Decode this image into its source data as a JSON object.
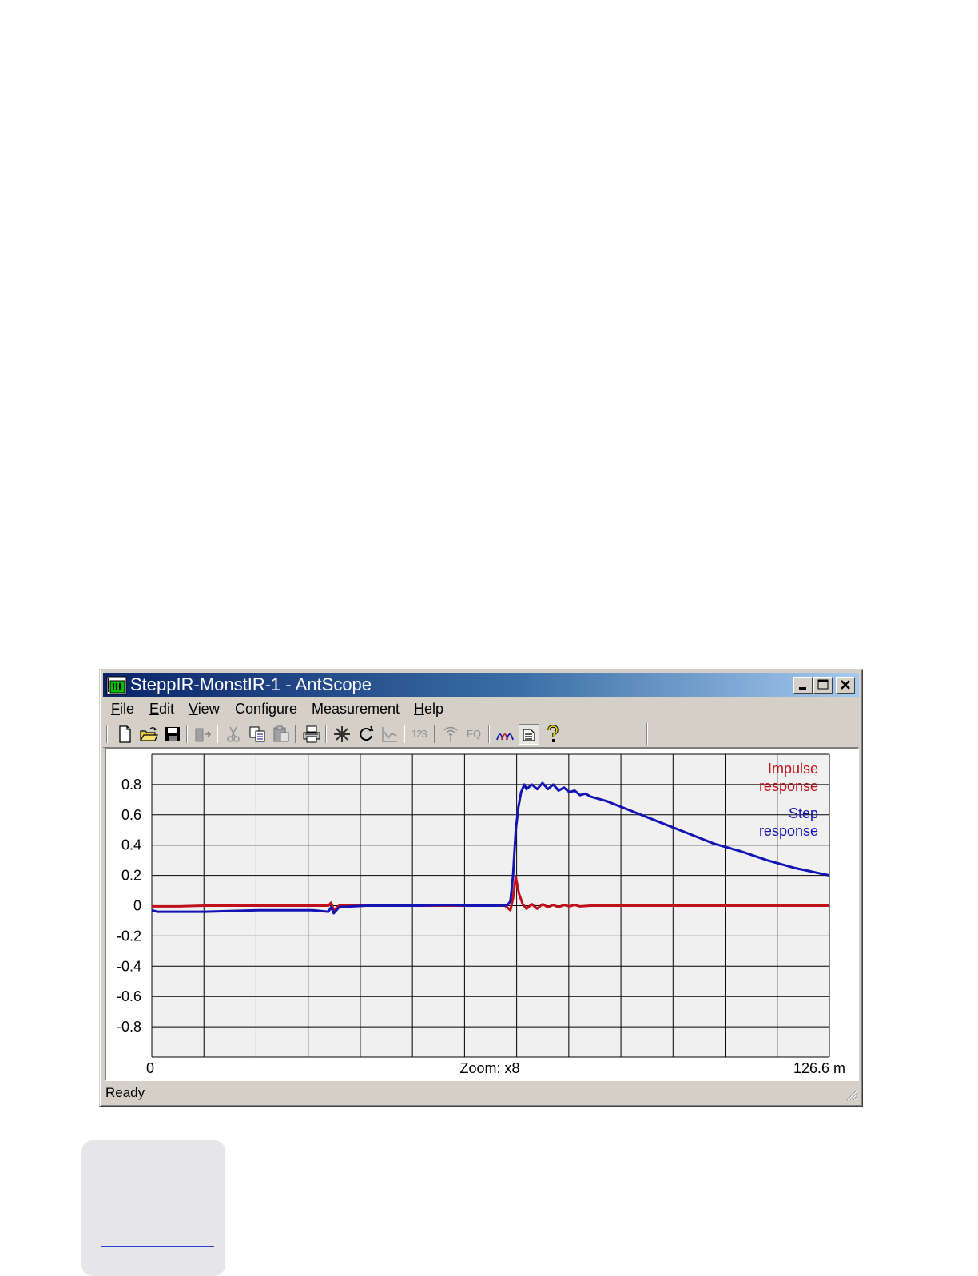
{
  "window": {
    "title": "SteppIR-MonstIR-1 - AntScope",
    "title_buttons": [
      "minimize-icon",
      "maximize-icon",
      "close-icon"
    ]
  },
  "menu": [
    {
      "underline": "F",
      "rest": "ile"
    },
    {
      "underline": "E",
      "rest": "dit"
    },
    {
      "underline": "V",
      "rest": "iew"
    },
    {
      "underline": "",
      "rest": "Configure"
    },
    {
      "underline": "",
      "rest": "Measurement"
    },
    {
      "underline": "H",
      "rest": "elp"
    }
  ],
  "toolbar": {
    "buttons": [
      {
        "icon": "new-document-icon",
        "enabled": true
      },
      {
        "icon": "open-folder-icon",
        "enabled": true
      },
      {
        "icon": "save-icon",
        "enabled": true
      },
      {
        "icon": "export-icon",
        "enabled": false
      },
      {
        "icon": "cut-icon",
        "enabled": false
      },
      {
        "icon": "copy-icon",
        "enabled": true
      },
      {
        "icon": "paste-icon",
        "enabled": false
      },
      {
        "icon": "print-icon",
        "enabled": true
      },
      {
        "icon": "scan-icon",
        "enabled": true
      },
      {
        "icon": "refresh-icon",
        "enabled": true
      },
      {
        "icon": "graph-icon",
        "enabled": false
      },
      {
        "icon": "numbers-icon",
        "label": "123",
        "enabled": false
      },
      {
        "icon": "antenna-icon",
        "enabled": false
      },
      {
        "icon": "fq-icon",
        "label": "FQ",
        "enabled": false
      },
      {
        "icon": "tdr-icon",
        "enabled": true
      },
      {
        "icon": "notes-icon",
        "enabled": true,
        "pressed": true
      },
      {
        "icon": "help-icon",
        "enabled": true
      }
    ]
  },
  "chart": {
    "x_start_label": "0",
    "x_center_label": "Zoom: x8",
    "x_end_label": "126.6 m",
    "legend": {
      "impulse_line1": "Impulse",
      "impulse_line2": "response",
      "step_line1": "Step",
      "step_line2": "response"
    },
    "colors": {
      "impulse": "#c0101a",
      "step": "#1414b4",
      "grid_bg": "#f0f0f0",
      "grid_line": "#000000"
    }
  },
  "chart_data": {
    "type": "line",
    "xlabel": "",
    "ylabel": "",
    "xlim": [
      0,
      126.6
    ],
    "ylim": [
      -1,
      1
    ],
    "yticks": [
      0.8,
      0.6,
      0.4,
      0.2,
      0,
      -0.2,
      -0.4,
      -0.6,
      -0.8
    ],
    "ytick_labels": [
      "0.8",
      "0.6",
      "0.4",
      "0.2",
      "0",
      "-0.2",
      "-0.4",
      "-0.6",
      "-0.8"
    ],
    "grid": true,
    "legend_position": "top-right",
    "series": [
      {
        "name": "Impulse response",
        "x": [
          0,
          5,
          10,
          20,
          30,
          33,
          33.5,
          34,
          35,
          40,
          50,
          60,
          66,
          67,
          67.5,
          68,
          68.6,
          69.3,
          70,
          71,
          72,
          73,
          74,
          75,
          76,
          77,
          78,
          79,
          80,
          82,
          84,
          86,
          90,
          95,
          100,
          105,
          110,
          115,
          120,
          126.6
        ],
        "y": [
          -0.005,
          -0.005,
          0.0,
          0.0,
          0.0,
          0.0,
          0.02,
          -0.03,
          0.0,
          0.0,
          0.0,
          0.0,
          0.0,
          -0.03,
          0.05,
          0.19,
          0.08,
          0.01,
          -0.02,
          0.01,
          -0.02,
          0.01,
          -0.01,
          0.005,
          -0.01,
          0.005,
          -0.005,
          0.005,
          -0.005,
          0.0,
          0.0,
          0.0,
          0.0,
          0.0,
          0.0,
          0.0,
          0.0,
          0.0,
          0.0,
          0.0
        ]
      },
      {
        "name": "Step response",
        "x": [
          0,
          1,
          5,
          10,
          15,
          20,
          25,
          30,
          33,
          33.5,
          34,
          35,
          40,
          50,
          55,
          60,
          65,
          66.5,
          67,
          67.5,
          68,
          68.5,
          69,
          69.6,
          70,
          71,
          72,
          73,
          74,
          75,
          76,
          77,
          78,
          79,
          80,
          81,
          82,
          85,
          90,
          95,
          100,
          105,
          110,
          115,
          120,
          126.6
        ],
        "y": [
          -0.03,
          -0.04,
          -0.04,
          -0.04,
          -0.035,
          -0.03,
          -0.03,
          -0.03,
          -0.04,
          -0.01,
          -0.05,
          -0.01,
          0.0,
          0.0,
          0.005,
          0.0,
          0.0,
          0.005,
          0.03,
          0.2,
          0.5,
          0.65,
          0.75,
          0.8,
          0.77,
          0.8,
          0.77,
          0.81,
          0.77,
          0.8,
          0.76,
          0.78,
          0.75,
          0.76,
          0.73,
          0.74,
          0.72,
          0.69,
          0.62,
          0.55,
          0.48,
          0.41,
          0.36,
          0.3,
          0.25,
          0.2
        ]
      }
    ]
  },
  "status": {
    "text": "Ready"
  }
}
